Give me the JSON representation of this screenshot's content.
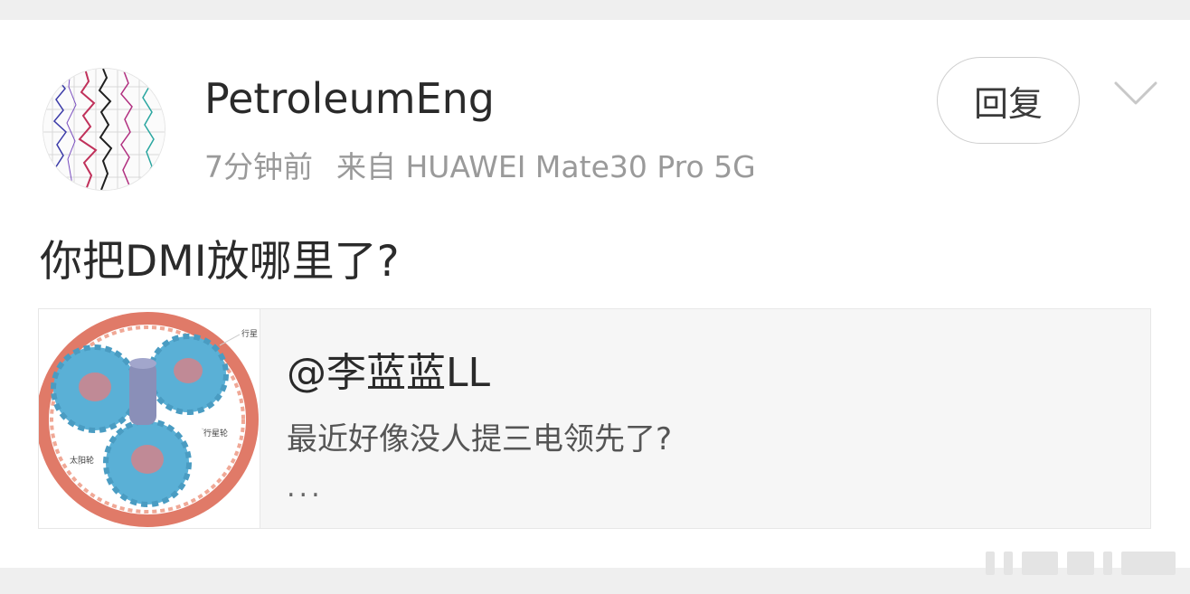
{
  "post": {
    "username": "PetroleumEng",
    "time": "7分钟前",
    "source": "来自 HUAWEI Mate30 Pro 5G",
    "reply_label": "回复",
    "comment_text": "你把DMI放哪里了?"
  },
  "quote": {
    "user": "@李蓝蓝LL",
    "text": "最近好像没人提三电领先了?",
    "more": "...",
    "thumb_labels": [
      "行星",
      "行星轮",
      "太阳轮"
    ]
  },
  "icons": {
    "avatar": "well-log-avatar",
    "chevron": "chevron-down-icon"
  },
  "colors": {
    "page_bg": "#efefef",
    "card_bg": "#ffffff",
    "quote_bg": "#f6f6f6",
    "gear_blue": "#5ab0d6",
    "ring_red": "#e07a68"
  }
}
